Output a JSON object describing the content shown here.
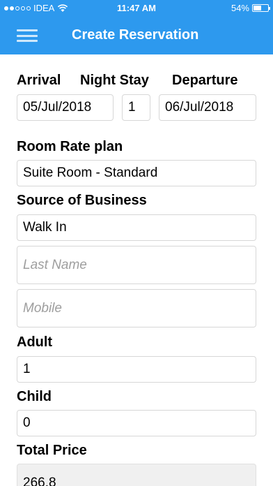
{
  "status_bar": {
    "carrier": "IDEA",
    "time": "11:47 AM",
    "battery": "54%",
    "battery_level": 0.54
  },
  "header": {
    "title": "Create Reservation"
  },
  "form": {
    "arrival_label": "Arrival",
    "night_stay_label": "Night Stay",
    "departure_label": "Departure",
    "arrival_value": "05/Jul/2018",
    "night_stay_value": "1",
    "departure_value": "06/Jul/2018",
    "room_rate_plan_label": "Room Rate plan",
    "room_rate_plan_value": "Suite Room - Standard",
    "source_of_business_label": "Source of Business",
    "source_of_business_value": "Walk In",
    "last_name_placeholder": "Last Name",
    "mobile_placeholder": "Mobile",
    "adult_label": "Adult",
    "adult_value": "1",
    "child_label": "Child",
    "child_value": "0",
    "total_price_label": "Total Price",
    "total_price_value": "266.8"
  }
}
